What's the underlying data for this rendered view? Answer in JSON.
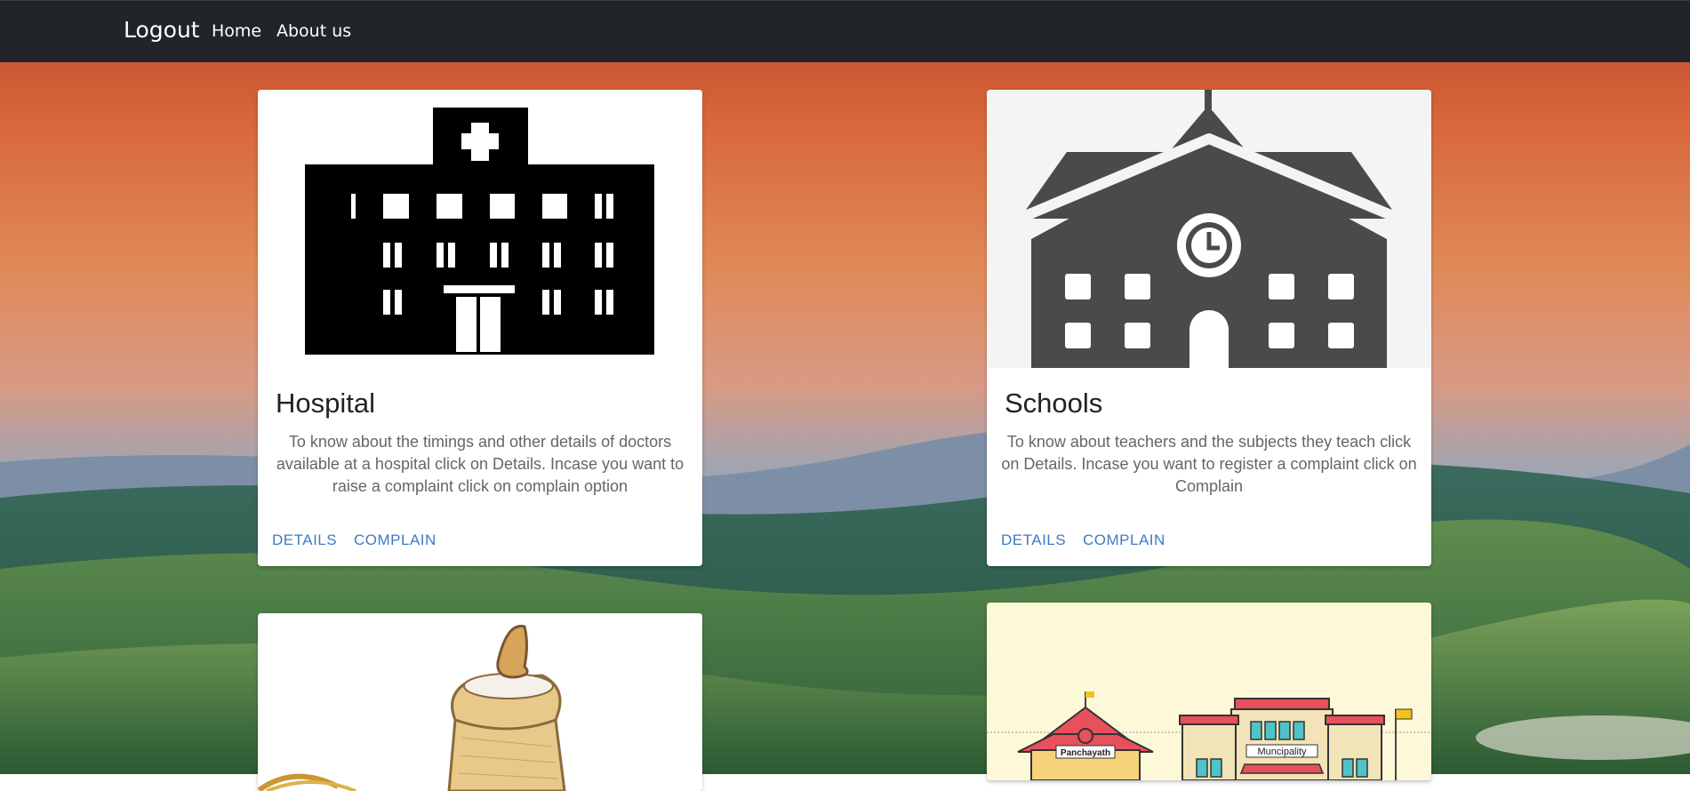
{
  "nav": {
    "brand": "Logout",
    "links": [
      "Home",
      "About us"
    ]
  },
  "cards": [
    {
      "title": "Hospital",
      "text": "To know about the timings and other details of doctors available at a hospital click on Details. Incase you want to raise a complaint click on complain option",
      "actions": [
        "DETAILS",
        "COMPLAIN"
      ]
    },
    {
      "title": "Schools",
      "text": "To know about teachers and the subjects they teach click on Details. Incase you want to register a complaint click on Complain",
      "actions": [
        "DETAILS",
        "COMPLAIN"
      ]
    },
    {
      "title": "",
      "text": "",
      "actions": []
    },
    {
      "title": "",
      "text": "",
      "actions": [],
      "image_labels": [
        "Panchayath",
        "Muncipality"
      ]
    }
  ],
  "colors": {
    "navbar": "#212529",
    "link_accent": "#3d7bc4",
    "sky_top": "#c2502c",
    "landscape": "#2f6a45"
  },
  "icons": [
    "hospital-building-icon",
    "school-building-icon",
    "flour-sack-icon",
    "panchayath-municipality-icon"
  ]
}
